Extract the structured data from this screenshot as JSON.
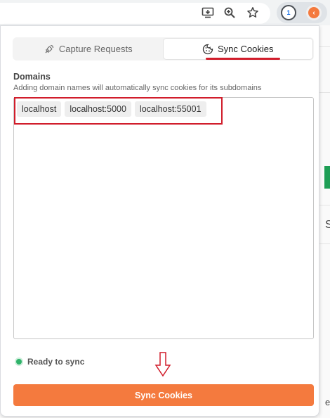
{
  "tabs": {
    "capture_label": "Capture Requests",
    "sync_label": "Sync Cookies"
  },
  "domains": {
    "title": "Domains",
    "subtitle": "Adding domain names will automatically sync cookies for its subdomains",
    "chips": [
      "localhost",
      "localhost:5000",
      "localhost:55001"
    ]
  },
  "status": {
    "text": "Ready to sync",
    "color": "#2fb36a"
  },
  "button": {
    "label": "Sync Cookies",
    "color": "#f47a3e"
  },
  "annotation": {
    "color": "#d11d2b"
  },
  "chrome_icons": [
    "install-app-icon",
    "zoom-icon",
    "bookmark-star-icon",
    "extension-a-icon",
    "extension-b-icon"
  ],
  "background_page": {
    "s_char": "S",
    "e_char": "e"
  }
}
